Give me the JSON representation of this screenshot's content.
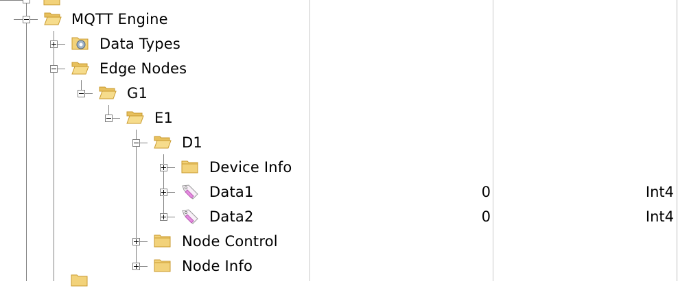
{
  "tree": {
    "nodes": [
      {
        "label": "MQTT Engine",
        "icon": "folder-open-icon",
        "expander": "minus"
      },
      {
        "label": "Data Types",
        "icon": "data-types-icon",
        "expander": "plus"
      },
      {
        "label": "Edge Nodes",
        "icon": "folder-open-icon",
        "expander": "minus"
      },
      {
        "label": "G1",
        "icon": "folder-open-icon",
        "expander": "minus"
      },
      {
        "label": "E1",
        "icon": "folder-open-icon",
        "expander": "minus"
      },
      {
        "label": "D1",
        "icon": "folder-open-icon",
        "expander": "minus"
      },
      {
        "label": "Device Info",
        "icon": "folder-closed-icon",
        "expander": "plus"
      },
      {
        "label": "Data1",
        "icon": "tag-icon",
        "expander": "plus",
        "value": "0",
        "type": "Int4"
      },
      {
        "label": "Data2",
        "icon": "tag-icon",
        "expander": "plus",
        "value": "0",
        "type": "Int4"
      },
      {
        "label": "Node Control",
        "icon": "folder-closed-icon",
        "expander": "plus"
      },
      {
        "label": "Node Info",
        "icon": "folder-closed-icon",
        "expander": "plus"
      }
    ]
  },
  "colors": {
    "folder_fill": "#f2d27a",
    "folder_dark": "#c99a2e",
    "tag_fill": "#f0b8ee",
    "grid_line": "#c8c8c8",
    "tree_line": "#808080"
  }
}
